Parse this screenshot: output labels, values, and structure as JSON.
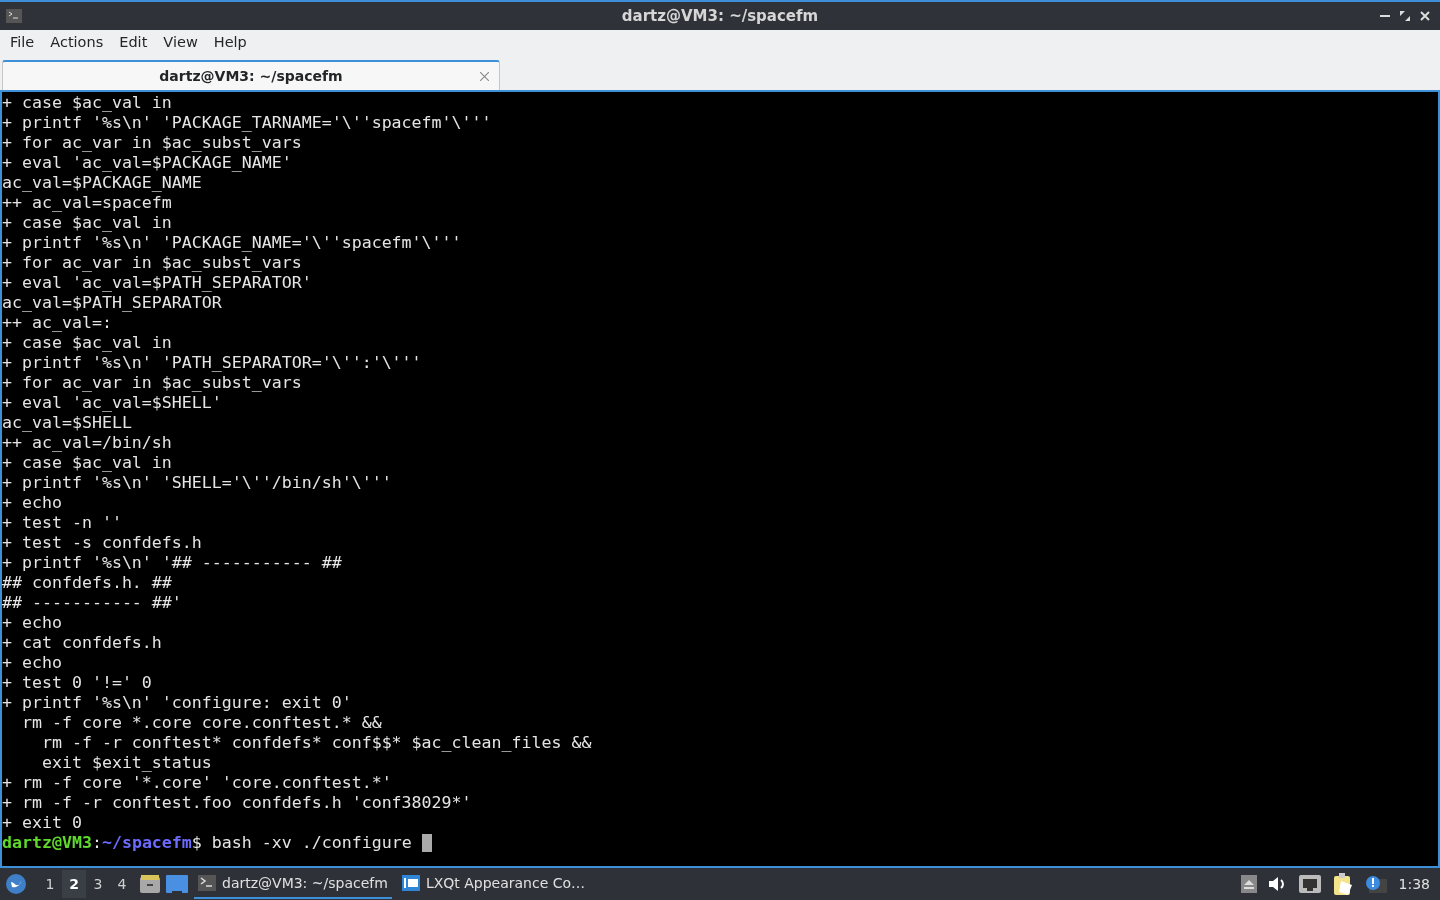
{
  "window": {
    "title": "dartz@VM3: ~/spacefm"
  },
  "menu": [
    "File",
    "Actions",
    "Edit",
    "View",
    "Help"
  ],
  "tabs": [
    {
      "label": "dartz@VM3: ~/spacefm",
      "selected": true
    }
  ],
  "terminal": {
    "lines": [
      "+ case $ac_val in",
      "+ printf '%s\\n' 'PACKAGE_TARNAME='\\''spacefm'\\'''",
      "+ for ac_var in $ac_subst_vars",
      "+ eval 'ac_val=$PACKAGE_NAME'",
      "ac_val=$PACKAGE_NAME",
      "++ ac_val=spacefm",
      "+ case $ac_val in",
      "+ printf '%s\\n' 'PACKAGE_NAME='\\''spacefm'\\'''",
      "+ for ac_var in $ac_subst_vars",
      "+ eval 'ac_val=$PATH_SEPARATOR'",
      "ac_val=$PATH_SEPARATOR",
      "++ ac_val=:",
      "+ case $ac_val in",
      "+ printf '%s\\n' 'PATH_SEPARATOR='\\'':'\\'''",
      "+ for ac_var in $ac_subst_vars",
      "+ eval 'ac_val=$SHELL'",
      "ac_val=$SHELL",
      "++ ac_val=/bin/sh",
      "+ case $ac_val in",
      "+ printf '%s\\n' 'SHELL='\\''/bin/sh'\\'''",
      "+ echo",
      "+ test -n ''",
      "+ test -s confdefs.h",
      "+ printf '%s\\n' '## ----------- ##",
      "## confdefs.h. ##",
      "## ----------- ##'",
      "+ echo",
      "+ cat confdefs.h",
      "+ echo",
      "+ test 0 '!=' 0",
      "+ printf '%s\\n' 'configure: exit 0'",
      "  rm -f core *.core core.conftest.* &&",
      "    rm -f -r conftest* confdefs* conf$$* $ac_clean_files &&",
      "    exit $exit_status",
      "+ rm -f core '*.core' 'core.conftest.*'",
      "+ rm -f -r conftest.foo confdefs.h 'conf38029*'",
      "+ exit 0"
    ],
    "prompt": [
      {
        "text": "dartz@VM3",
        "kind": "user"
      },
      {
        "text": ":",
        "kind": "plain"
      },
      {
        "text": "~/spacefm",
        "kind": "path"
      },
      {
        "text": "$ bash -xv ./configure",
        "kind": "plain"
      }
    ]
  },
  "taskbar": {
    "workspaces": [
      {
        "label": "1",
        "selected": false
      },
      {
        "label": "2",
        "selected": true
      },
      {
        "label": "3",
        "selected": false
      },
      {
        "label": "4",
        "selected": false
      }
    ],
    "tasks": [
      {
        "label": "dartz@VM3: ~/spacefm",
        "kind": "terminal",
        "selected": true
      },
      {
        "label": "LXQt Appearance Co…",
        "kind": "appearance",
        "selected": false
      }
    ],
    "clock": "1:38"
  }
}
